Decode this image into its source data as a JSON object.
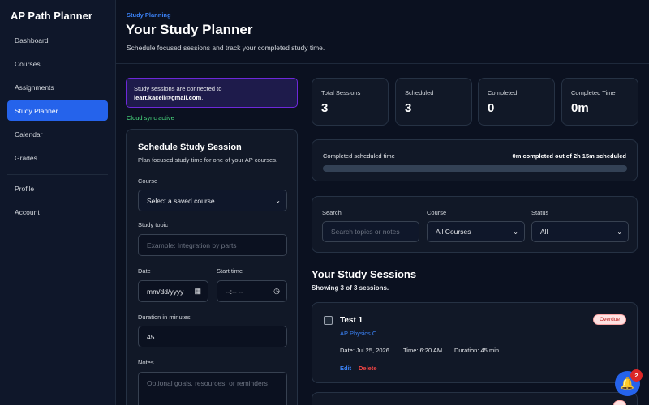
{
  "app": {
    "brand": "AP Path Planner"
  },
  "sidebar": {
    "items": [
      {
        "label": "Dashboard"
      },
      {
        "label": "Courses"
      },
      {
        "label": "Assignments"
      },
      {
        "label": "Study Planner"
      },
      {
        "label": "Calendar"
      },
      {
        "label": "Grades"
      },
      {
        "label": "Profile"
      },
      {
        "label": "Account"
      }
    ],
    "active": "Study Planner"
  },
  "header": {
    "eyebrow": "Study Planning",
    "title": "Your Study Planner",
    "subtitle": "Schedule focused sessions and track your completed study time."
  },
  "sync": {
    "notice_text": "Study sessions are connected to",
    "email": "leart.kaceli@gmail.com",
    "period": ".",
    "status": "Cloud sync active"
  },
  "form": {
    "title": "Schedule Study Session",
    "description": "Plan focused study time for one of your AP courses.",
    "course_label": "Course",
    "course_value": "Select a saved course",
    "topic_label": "Study topic",
    "topic_placeholder": "Example: Integration by parts",
    "date_label": "Date",
    "date_placeholder": "mm/dd/yyyy",
    "time_label": "Start time",
    "time_placeholder": "--:-- --",
    "duration_label": "Duration in minutes",
    "duration_value": "45",
    "notes_label": "Notes",
    "notes_placeholder": "Optional goals, resources, or reminders"
  },
  "stats": [
    {
      "label": "Total Sessions",
      "value": "3"
    },
    {
      "label": "Scheduled",
      "value": "3"
    },
    {
      "label": "Completed",
      "value": "0"
    },
    {
      "label": "Completed Time",
      "value": "0m"
    }
  ],
  "progress": {
    "label": "Completed scheduled time",
    "summary": "0m completed out of 2h 15m scheduled",
    "fraction": 0
  },
  "filters": {
    "search_label": "Search",
    "search_placeholder": "Search topics or notes",
    "course_label": "Course",
    "course_value": "All Courses",
    "status_label": "Status",
    "status_value": "All"
  },
  "sessions_section": {
    "title": "Your Study Sessions",
    "count_text": "Showing 3 of 3 sessions."
  },
  "sessions": [
    {
      "title": "Test 1",
      "course": "AP Physics C",
      "date": "Date: Jul 25, 2026",
      "time": "Time: 6:20 AM",
      "duration": "Duration: 45 min",
      "status": "Overdue",
      "edit": "Edit",
      "delete": "Delete"
    }
  ],
  "notifications": {
    "count": "2"
  },
  "colors": {
    "accent": "#2563eb",
    "background": "#0b1120",
    "card": "#111827",
    "success": "#4ade80",
    "danger": "#ef4444"
  }
}
